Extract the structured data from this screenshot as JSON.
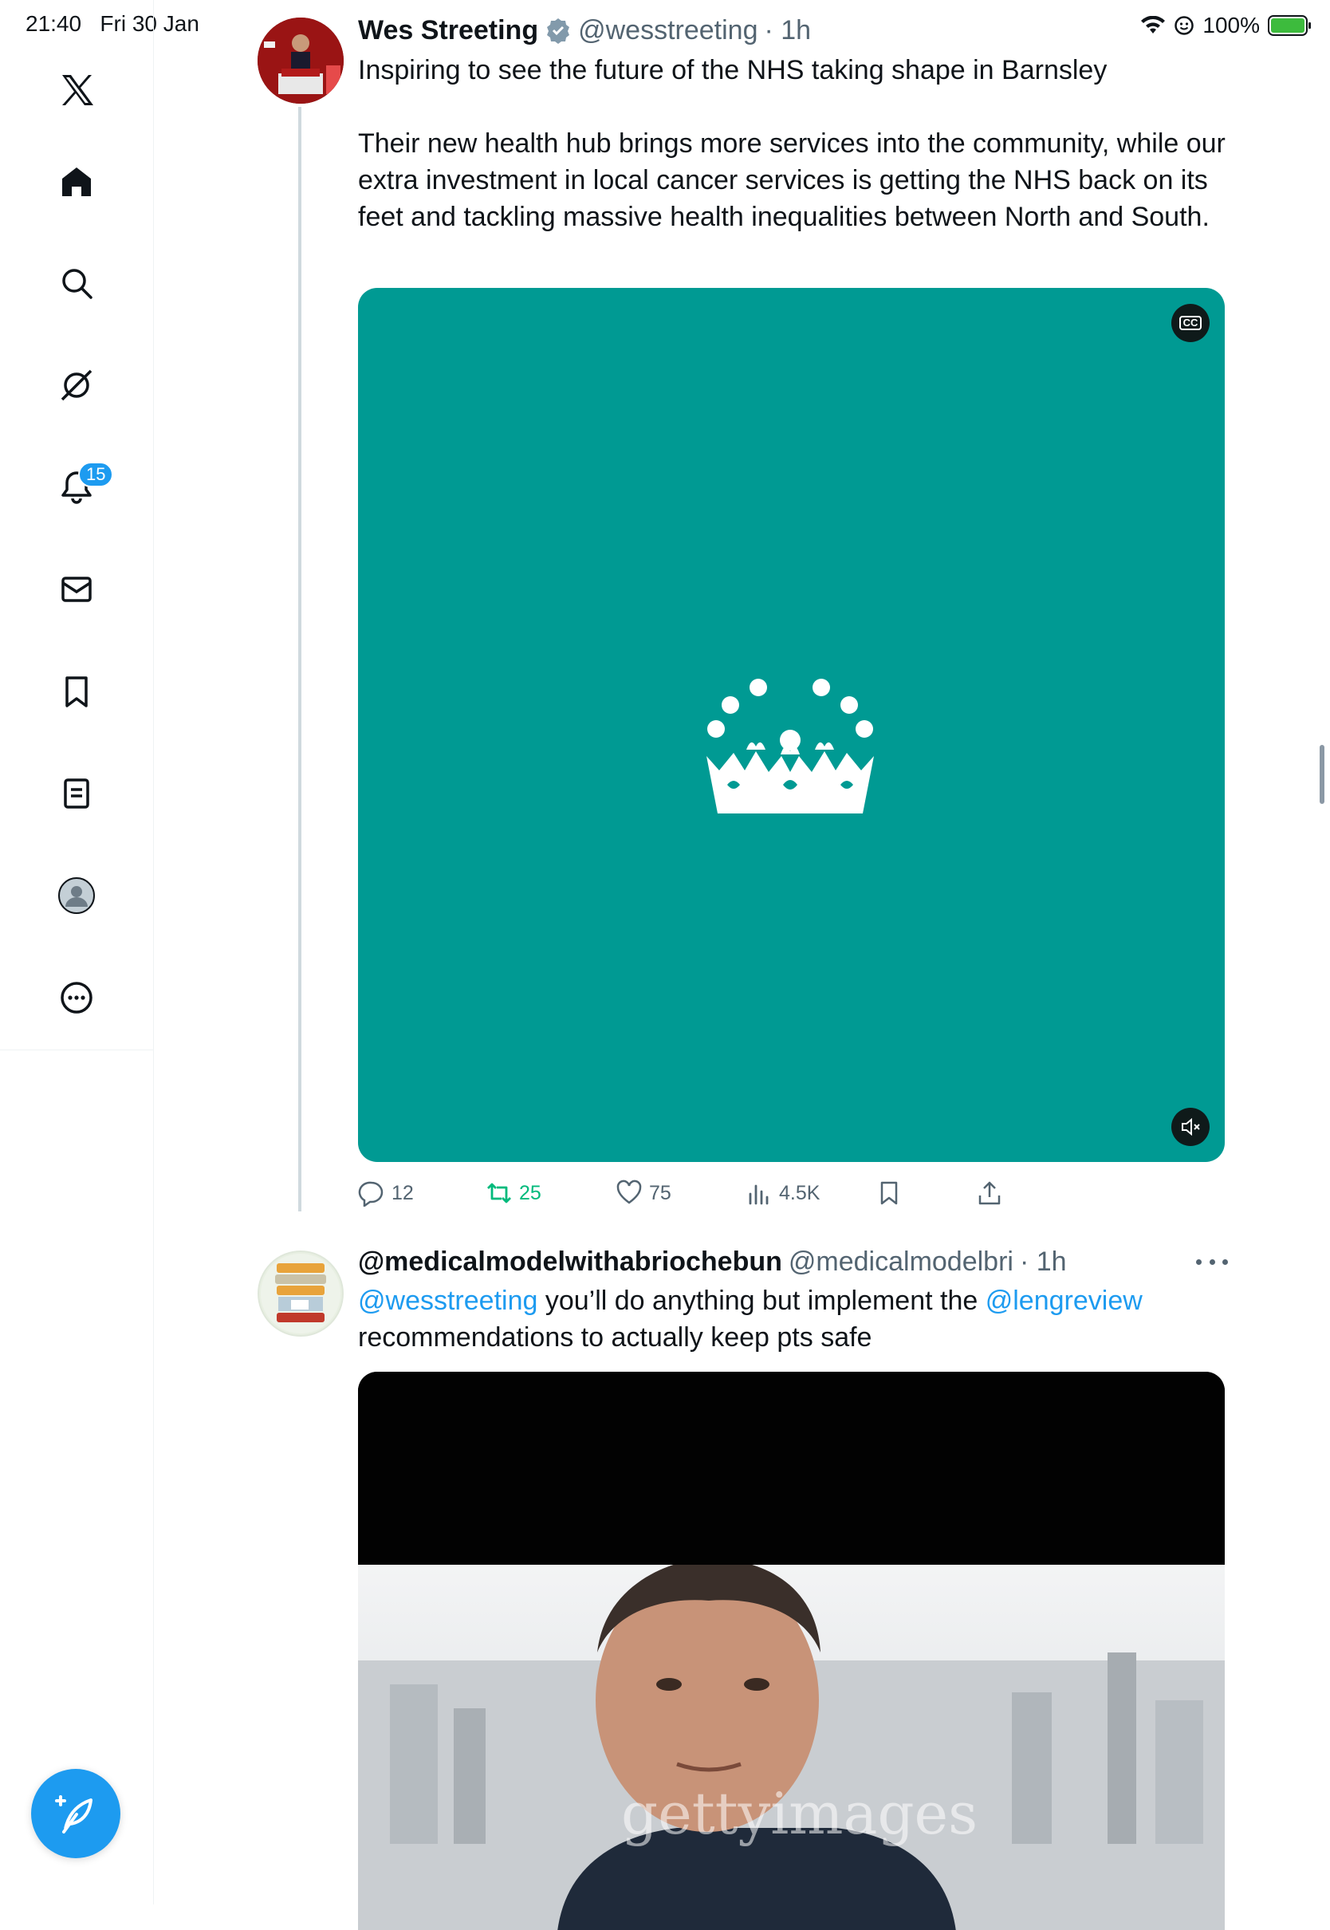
{
  "status_bar": {
    "time": "21:40",
    "date": "Fri 30 Jan",
    "battery": "100%",
    "icons": [
      "wifi-icon",
      "focus-icon",
      "battery-charging-icon"
    ]
  },
  "sidebar": {
    "items": [
      {
        "name": "x-logo",
        "icon": "x-logo-icon"
      },
      {
        "name": "home",
        "icon": "home-icon"
      },
      {
        "name": "explore",
        "icon": "search-icon"
      },
      {
        "name": "grok",
        "icon": "grok-icon"
      },
      {
        "name": "notifications",
        "icon": "bell-icon",
        "badge": "15"
      },
      {
        "name": "messages",
        "icon": "mail-icon"
      },
      {
        "name": "bookmarks",
        "icon": "bookmark-icon"
      },
      {
        "name": "lists",
        "icon": "list-icon"
      },
      {
        "name": "profile",
        "icon": "avatar-icon"
      },
      {
        "name": "more",
        "icon": "more-circle-icon"
      }
    ],
    "compose_icon": "compose-feather-icon"
  },
  "tweet1": {
    "name": "Wes Streeting",
    "handle": "@wesstreeting",
    "time": "· 1h",
    "line1": "Inspiring to see the future of the NHS taking shape in Barnsley",
    "body": "Their new health hub brings more services into the community, while our extra investment in local cancer services is getting the NHS back on its feet and tackling massive health inequalities between North and South.",
    "media_color": "#009a93",
    "cc_label": "CC",
    "stats": {
      "replies": "12",
      "retweets": "25",
      "likes": "75",
      "views": "4.5K"
    }
  },
  "tweet2": {
    "name": "@medicalmodelwithabriochebun",
    "handle": "@medicalmodelbri",
    "time": "· 1h",
    "mention1": "@wesstreeting",
    "text1": " you’ll do anything but implement the ",
    "mention2": "@lengreview",
    "text2": "recommendations to actually keep pts safe",
    "watermark": "gettyimages"
  },
  "colors": {
    "accent": "#1d9bf0",
    "retweet_green": "#00ba7c",
    "muted": "#536471"
  }
}
